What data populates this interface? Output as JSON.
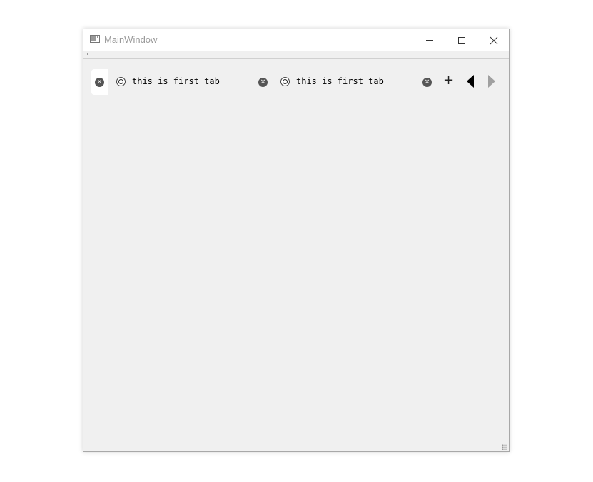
{
  "window": {
    "title": "MainWindow"
  },
  "tabs": {
    "items": [
      {
        "label": "this is first tab",
        "close_glyph": "×"
      },
      {
        "label": "this is first tab",
        "close_glyph": "×"
      }
    ],
    "partial_close_glyph": "×",
    "add_glyph": "+"
  },
  "icons": {
    "app": "app-window-icon",
    "tab_icon": "gear-circle-icon",
    "close": "close-circle-icon",
    "add": "plus-icon",
    "scroll_left": "triangle-left-icon",
    "scroll_right": "triangle-right-icon"
  },
  "colors": {
    "window_bg": "#f0f0f0",
    "titlebar_bg": "#ffffff",
    "title_text": "#999999",
    "active_tab_bg": "#ffffff",
    "close_circle": "#555555",
    "scroll_right_disabled": "#a0a0a0"
  }
}
